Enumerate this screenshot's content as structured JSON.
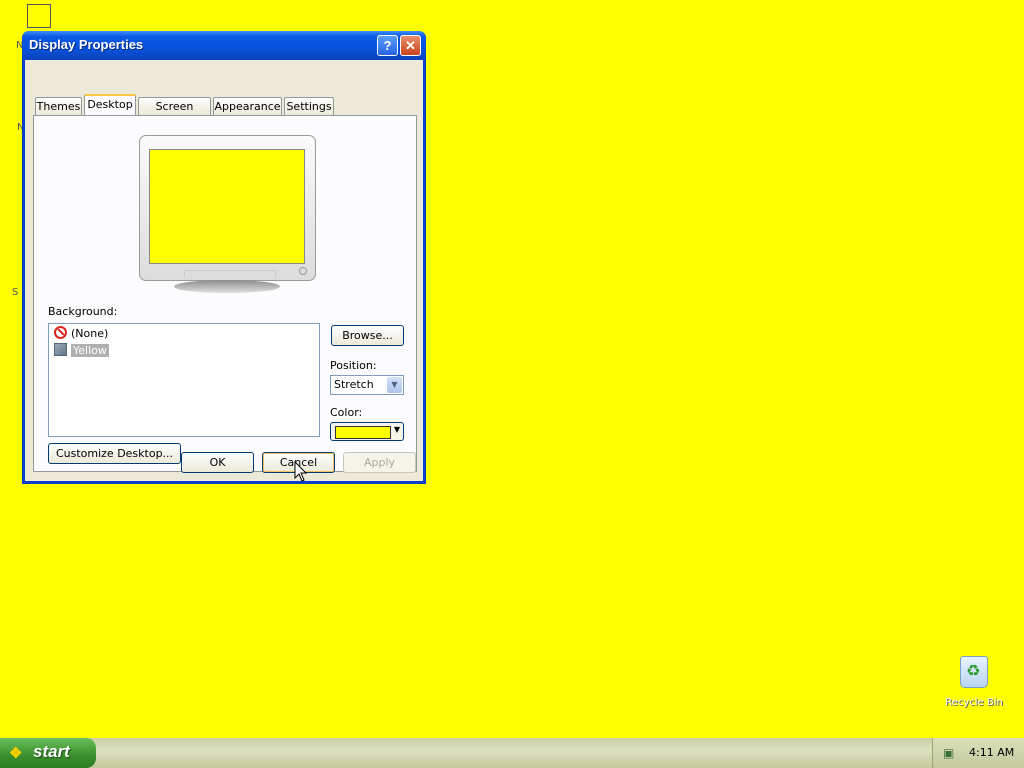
{
  "window": {
    "title": "Display Properties",
    "help_label": "?",
    "close_label": "✕"
  },
  "tabs": [
    {
      "label": "Themes"
    },
    {
      "label": "Desktop"
    },
    {
      "label": "Screen Saver"
    },
    {
      "label": "Appearance"
    },
    {
      "label": "Settings"
    }
  ],
  "active_tab": "Desktop",
  "desktop": {
    "background_label": "Background:",
    "background_items": [
      {
        "label": "(None)",
        "icon": "none-icon"
      },
      {
        "label": "Yellow",
        "icon": "image-icon",
        "selected": true
      }
    ],
    "browse_label": "Browse...",
    "position_label": "Position:",
    "position_value": "Stretch",
    "color_label": "Color:",
    "color_value": "#FFFF00",
    "customize_label": "Customize Desktop..."
  },
  "buttons": {
    "ok": "OK",
    "cancel": "Cancel",
    "apply": "Apply"
  },
  "desktop_icons": {
    "recycle_bin": "Recycle Bin"
  },
  "taskbar": {
    "start_label": "start",
    "clock": "4:11 AM"
  },
  "colors": {
    "desktop_background": "#FFFF00",
    "titlebar": "#0A58E6",
    "dialog_face": "#ECE9D8"
  }
}
